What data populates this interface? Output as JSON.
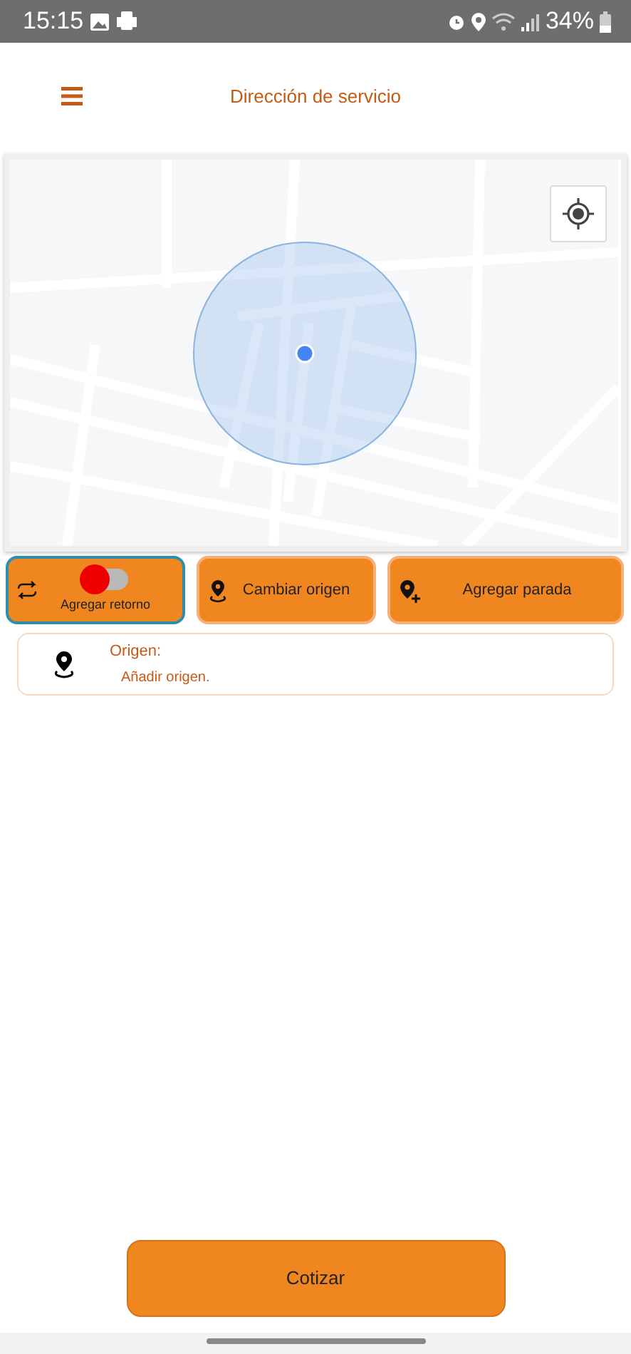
{
  "status_bar": {
    "time": "15:15",
    "battery": "34%"
  },
  "header": {
    "title": "Dirección de servicio"
  },
  "actions": [
    {
      "kind": "toggle",
      "label": "Agregar retorno",
      "checked": false,
      "selected": true
    },
    {
      "kind": "button",
      "label": "Cambiar origen",
      "selected": false
    },
    {
      "kind": "button",
      "label": "Agregar parada",
      "selected": false
    }
  ],
  "origin": {
    "label": "Origen:",
    "value": "Añadir origen."
  },
  "submit": {
    "label": "Cotizar"
  }
}
